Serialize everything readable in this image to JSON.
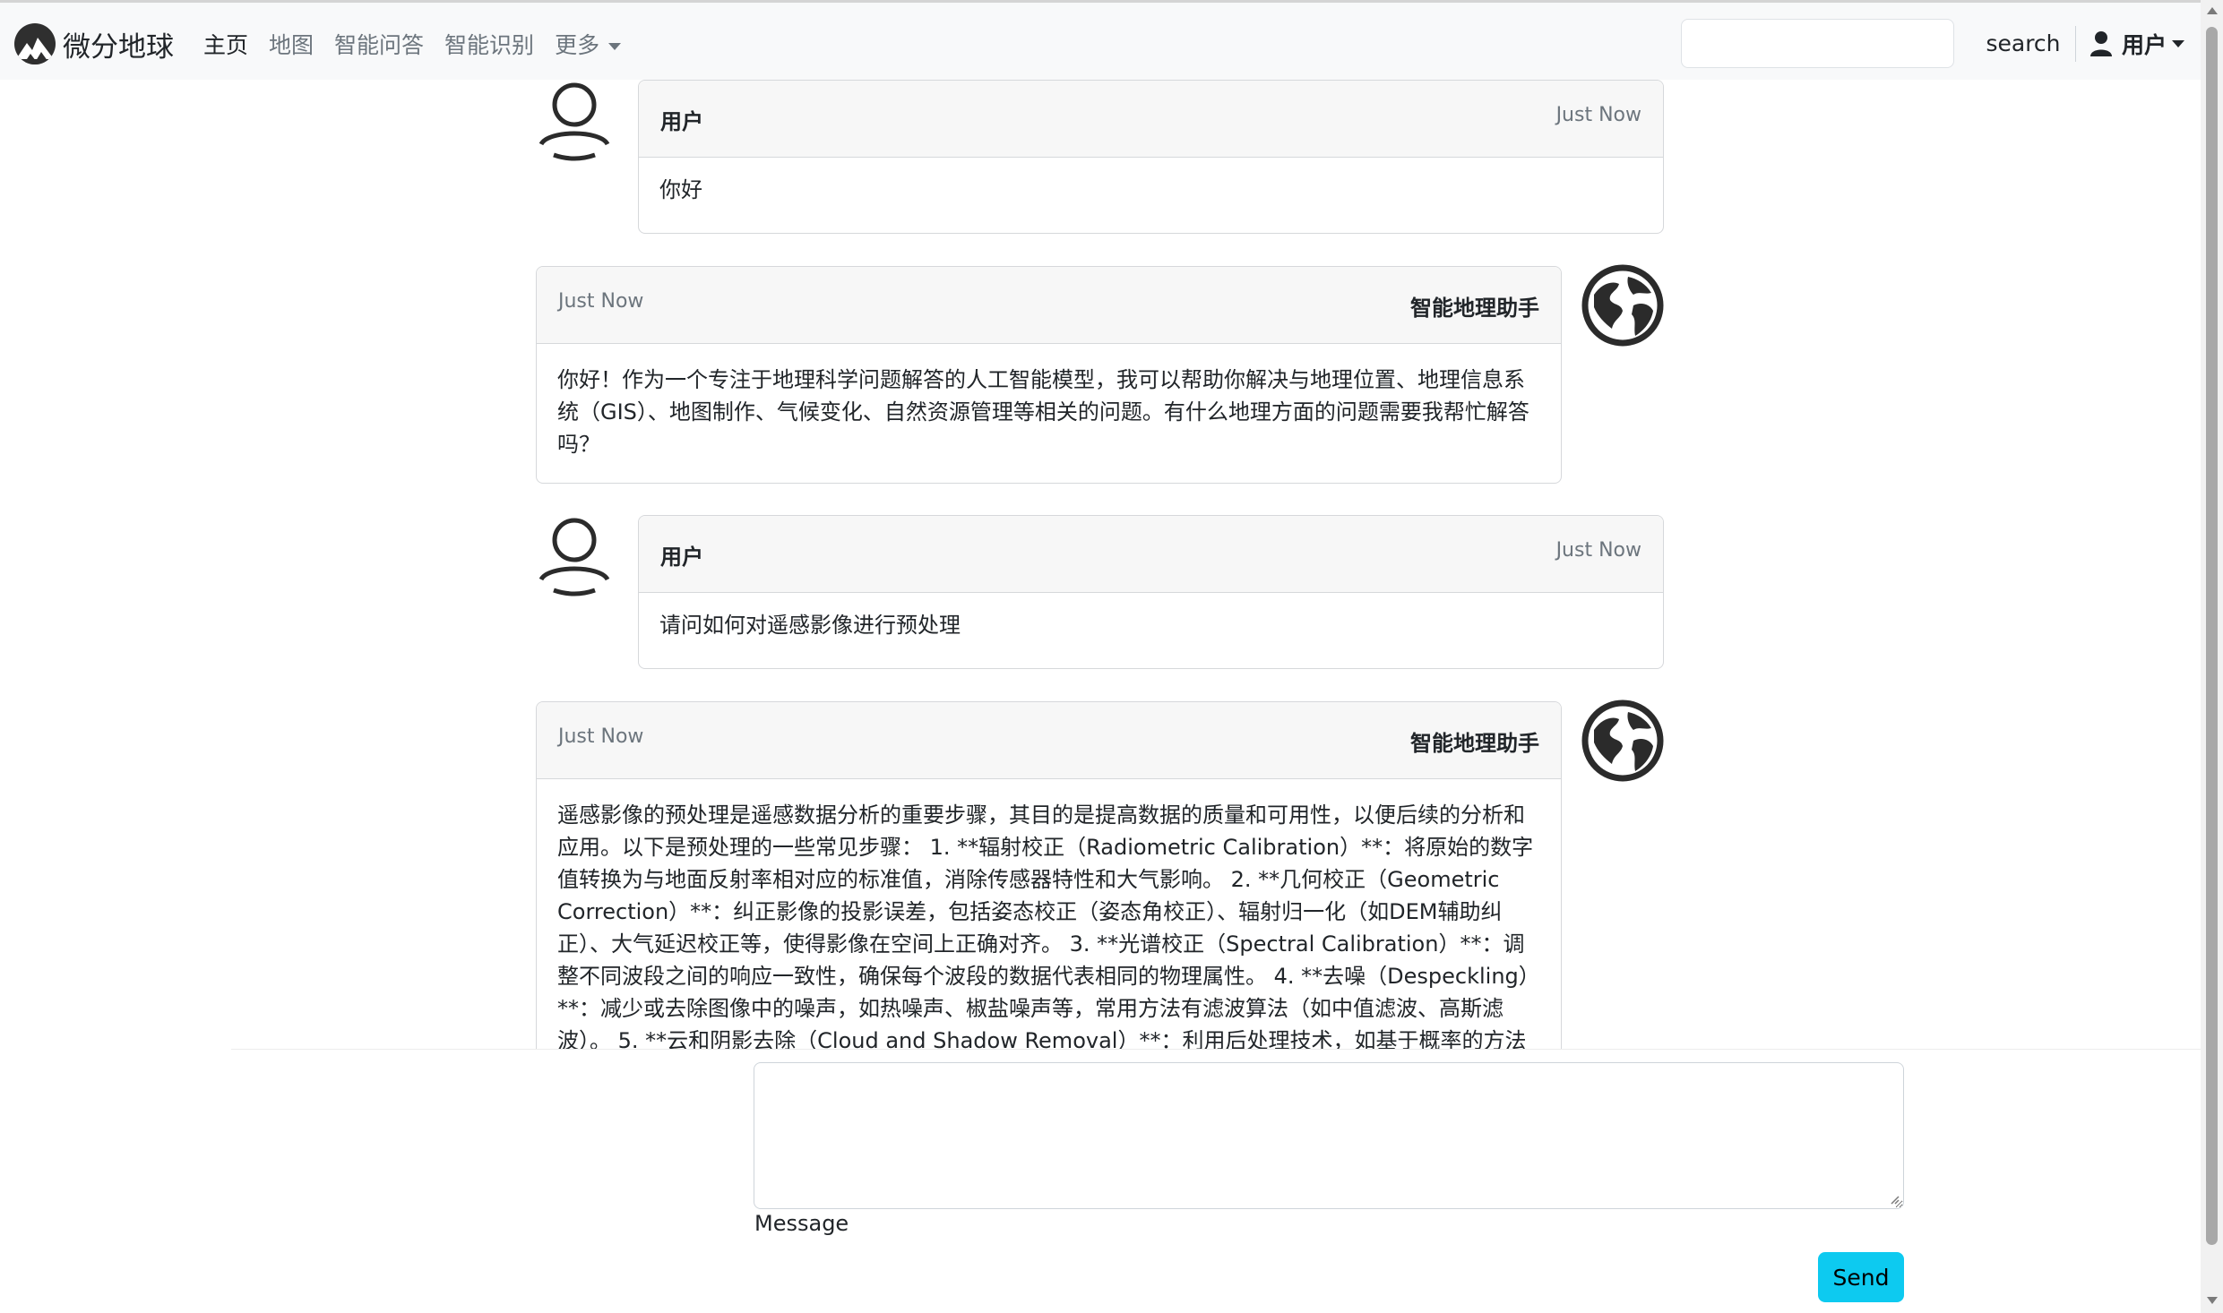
{
  "navbar": {
    "brand": "微分地球",
    "links": [
      {
        "label": "主页",
        "active": true
      },
      {
        "label": "地图",
        "active": false
      },
      {
        "label": "智能问答",
        "active": false
      },
      {
        "label": "智能识别",
        "active": false
      }
    ],
    "more_label": "更多",
    "search_placeholder": "",
    "search_button": "search",
    "user_menu_label": "用户"
  },
  "messages": [
    {
      "role": "user",
      "sender": "用户",
      "time": "Just Now",
      "text": "你好"
    },
    {
      "role": "assistant",
      "sender": "智能地理助手",
      "time": "Just Now",
      "text": "你好！作为一个专注于地理科学问题解答的人工智能模型，我可以帮助你解决与地理位置、地理信息系统（GIS）、地图制作、气候变化、自然资源管理等相关的问题。有什么地理方面的问题需要我帮忙解答吗？"
    },
    {
      "role": "user",
      "sender": "用户",
      "time": "Just Now",
      "text": "请问如何对遥感影像进行预处理"
    },
    {
      "role": "assistant",
      "sender": "智能地理助手",
      "time": "Just Now",
      "text": "遥感影像的预处理是遥感数据分析的重要步骤，其目的是提高数据的质量和可用性，以便后续的分析和应用。以下是预处理的一些常见步骤： 1. **辐射校正（Radiometric Calibration）**：将原始的数字值转换为与地面反射率相对应的标准值，消除传感器特性和大气影响。 2. **几何校正（Geometric Correction）**：纠正影像的投影误差，包括姿态校正（姿态角校正）、辐射归一化（如DEM辅助纠正）、大气延迟校正等，使得影像在空间上正确对齐。 3. **光谱校正（Spectral Calibration）**：调整不同波段之间的响应一致性，确保每个波段的数据代表相同的物理属性。 4. **去噪（Despeckling）**：减少或去除图像中的噪声，如热噪声、椒盐噪声等，常用方法有滤波算法（如中值滤波、高斯滤波）。 5. **云和阴影去除（Cloud and Shadow Removal）**：利用后处理技术，如基于概率的方法"
    }
  ],
  "composer": {
    "message_value": "",
    "label": "Message",
    "send_label": "Send"
  },
  "colors": {
    "navbar_bg": "#f8f9fa",
    "send_button": "#0dcaf0",
    "card_header_bg": "#f7f7f7",
    "border": "#d6d8db"
  }
}
